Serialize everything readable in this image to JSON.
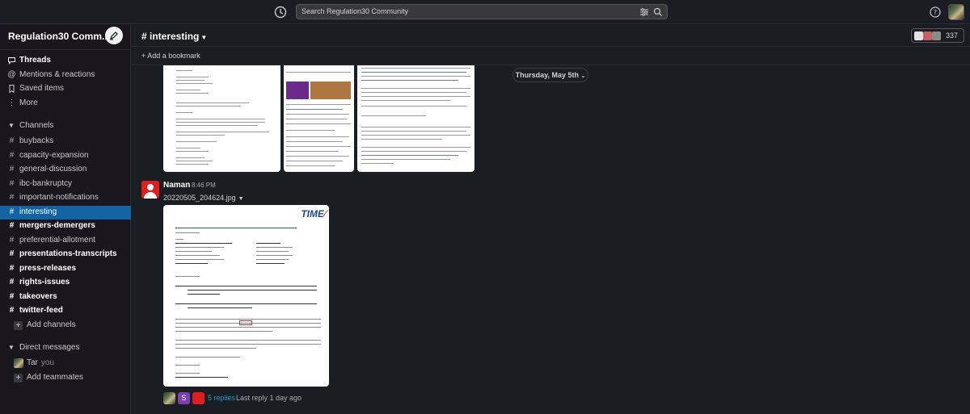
{
  "topbar": {
    "search_placeholder": "Search Regulation30 Community",
    "history_icon": "clock-icon",
    "help_icon": "help-icon"
  },
  "sidebar": {
    "workspace_name": "Regulation30 Comm...",
    "top_items": [
      {
        "label": "Threads",
        "icon": "threads-icon"
      },
      {
        "label": "Mentions & reactions",
        "icon": "at-icon"
      },
      {
        "label": "Saved items",
        "icon": "bookmark-icon"
      },
      {
        "label": "More",
        "icon": "more-icon"
      }
    ],
    "channels_header": "Channels",
    "channels": [
      {
        "label": "buybacks",
        "bold": false
      },
      {
        "label": "capacity-expansion",
        "bold": false
      },
      {
        "label": "general-discussion",
        "bold": false
      },
      {
        "label": "ibc-bankruptcy",
        "bold": false
      },
      {
        "label": "important-notifications",
        "bold": false
      },
      {
        "label": "interesting",
        "bold": false,
        "selected": true
      },
      {
        "label": "mergers-demergers",
        "bold": true
      },
      {
        "label": "preferential-allotment",
        "bold": false
      },
      {
        "label": "presentations-transcripts",
        "bold": true
      },
      {
        "label": "press-releases",
        "bold": true
      },
      {
        "label": "rights-issues",
        "bold": true
      },
      {
        "label": "takeovers",
        "bold": true
      },
      {
        "label": "twitter-feed",
        "bold": true
      }
    ],
    "add_channels": "Add channels",
    "dm_header": "Direct messages",
    "dm_user": "Tar",
    "dm_you": "you",
    "add_teammates": "Add teammates"
  },
  "channel": {
    "name": "# interesting",
    "member_count": "337",
    "add_bookmark": "Add a bookmark",
    "date_divider": "Thursday, May 5th"
  },
  "message": {
    "author": "Naman",
    "time": "8:46 PM",
    "file_name": "20220505_204624.jpg",
    "doc_logo_main": "TIME",
    "reply_count": "5 replies",
    "last_reply": "Last reply 1 day ago",
    "reply_avatar_letter": "S"
  },
  "colors": {
    "selected_channel": "#1164a3",
    "sidebar_bg": "#19171d",
    "main_bg": "#1a1d21",
    "link": "#1d9bd1",
    "avatar_red": "#e01e1e"
  }
}
